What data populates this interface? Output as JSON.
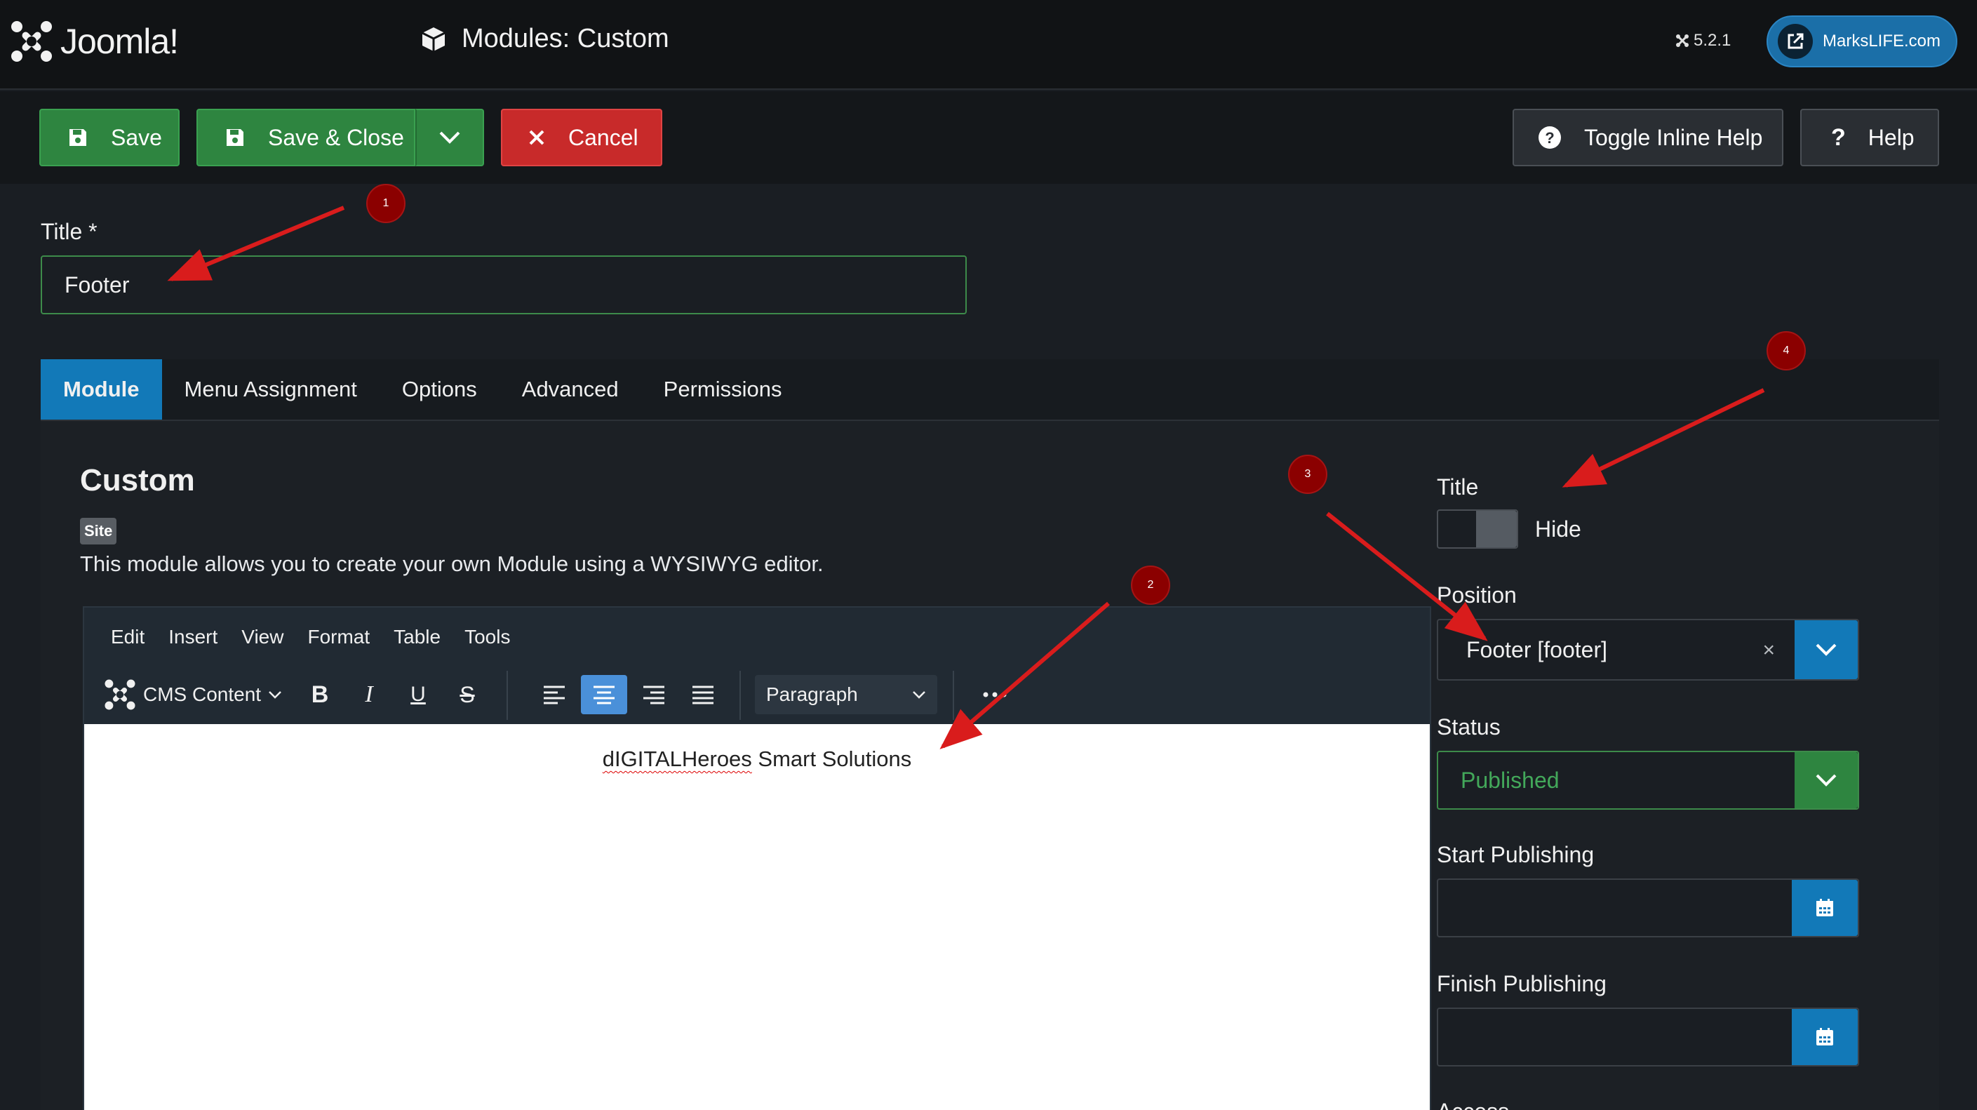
{
  "header": {
    "logo_text": "Joomla!",
    "page_title": "Modules: Custom",
    "version": "5.2.1",
    "site_link": "MarksLIFE.com"
  },
  "toolbar": {
    "save_label": "Save",
    "save_close_label": "Save & Close",
    "cancel_label": "Cancel",
    "toggle_help_label": "Toggle Inline Help",
    "help_label": "Help"
  },
  "form": {
    "title_label": "Title *",
    "title_value": "Footer"
  },
  "tabs": [
    {
      "label": "Module",
      "active": true
    },
    {
      "label": "Menu Assignment",
      "active": false
    },
    {
      "label": "Options",
      "active": false
    },
    {
      "label": "Advanced",
      "active": false
    },
    {
      "label": "Permissions",
      "active": false
    }
  ],
  "module": {
    "heading": "Custom",
    "badge": "Site",
    "description": "This module allows you to create your own Module using a WYSIWYG editor."
  },
  "editor": {
    "menu": [
      "Edit",
      "Insert",
      "View",
      "Format",
      "Table",
      "Tools"
    ],
    "cms_content_label": "CMS Content",
    "block_format": "Paragraph",
    "content_misspelled": "dIGITALHeroes",
    "content_rest": " Smart Solutions"
  },
  "sidebar": {
    "title_label": "Title",
    "title_toggle_label": "Hide",
    "position_label": "Position",
    "position_value": "Footer [footer]",
    "status_label": "Status",
    "status_value": "Published",
    "start_publishing_label": "Start Publishing",
    "finish_publishing_label": "Finish Publishing",
    "access_label": "Access"
  },
  "annotations": [
    "1",
    "2",
    "3",
    "4"
  ],
  "colors": {
    "success": "#2e8540",
    "danger": "#c82a2a",
    "primary": "#1279b8",
    "annotation": "#8b0000",
    "arrow": "#d91c1c"
  }
}
